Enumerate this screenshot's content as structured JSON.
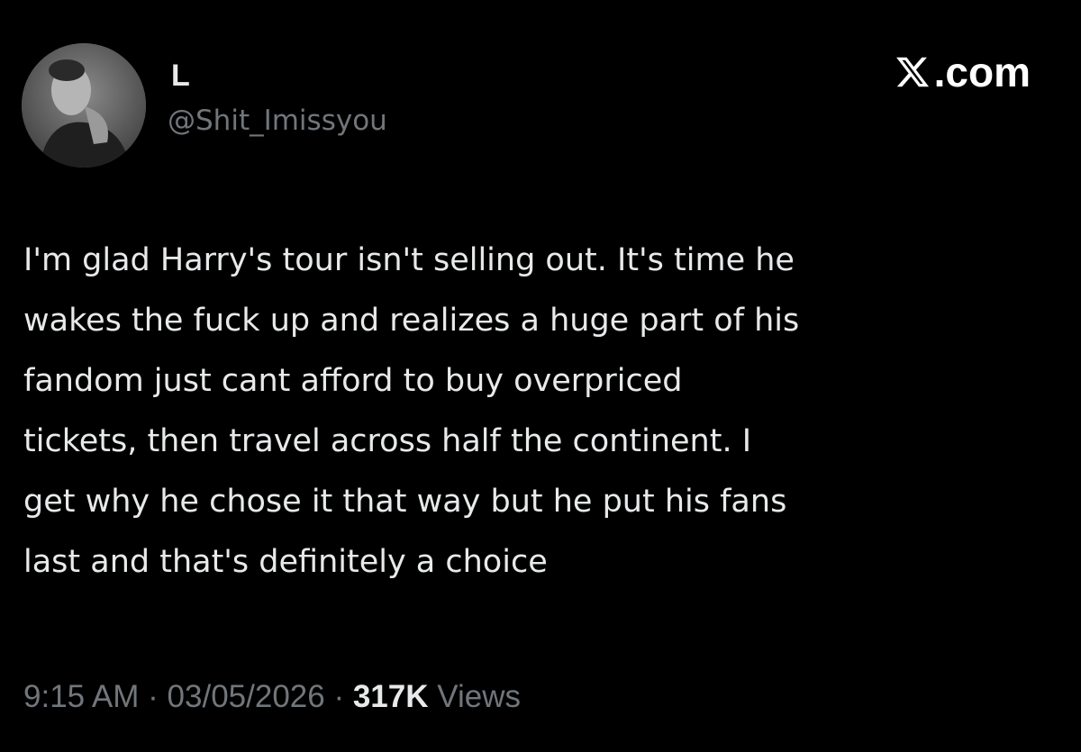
{
  "author": {
    "display_name": "L",
    "handle": "@Shit_Imissyou"
  },
  "brand": {
    "logo_icon": "x-logo-icon",
    "logo_suffix": ".com"
  },
  "tweet": {
    "text_lines": [
      "I'm glad Harry's tour isn't selling out. It's time he",
      "wakes the fuck up and realizes a huge part of his",
      "fandom just cant afford to buy overpriced",
      "tickets, then travel across half the continent. I",
      "get why he chose it that way but he put his fans",
      "last and that's definitely a choice"
    ]
  },
  "meta": {
    "time": "9:15 AM",
    "separator": "·",
    "date": "03/05/2026",
    "views_count": "317K",
    "views_label": "Views"
  },
  "colors": {
    "background": "#000000",
    "primary_text": "#e7e9ea",
    "secondary_text": "#71767b"
  }
}
